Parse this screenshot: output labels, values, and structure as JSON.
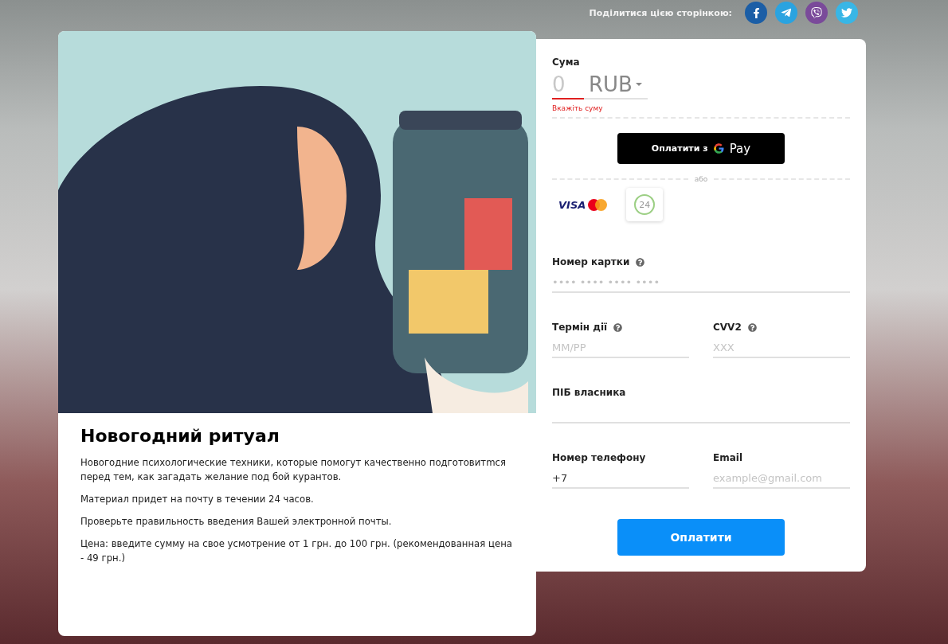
{
  "share": {
    "label": "Поділитися цією сторінкою:",
    "links": [
      {
        "kind": "facebook",
        "color": "#1b5ea6"
      },
      {
        "kind": "telegram",
        "color": "#2aa3e0"
      },
      {
        "kind": "viber",
        "color": "#7a4a9a"
      },
      {
        "kind": "twitter",
        "color": "#38b6e6"
      }
    ]
  },
  "product": {
    "title": "Новогодний ритуал",
    "paragraphs": [
      "Новогодние психологические техники, которые помогут качественно подготовитmся перед тем, как загадать желание под бой курантов.",
      "Материал придет на почту в течении 24 часов.",
      "Проверьте правильность введения Вашей электронной почты.",
      "Цена: введите сумму на свое усмотрение от 1 грн. до 100 грн. (рекомендованная цена - 49 грн.)"
    ]
  },
  "payment": {
    "amount": {
      "label": "Сума",
      "placeholder": "0",
      "currency": "RUB",
      "error": "Вкажіть суму"
    },
    "gpay": {
      "label": "Оплатити з",
      "brand": "Pay"
    },
    "divider": "або",
    "methods": [
      {
        "kind": "cards",
        "text": "VISA"
      },
      {
        "kind": "privat24",
        "text": "24"
      }
    ],
    "field_rows": [
      [
        {
          "label": "Номер картки",
          "help": true,
          "placeholder": "•••• •••• •••• ••••"
        }
      ],
      [
        {
          "label": "Термін дії",
          "help": true,
          "placeholder": "ММ/РР"
        },
        {
          "label": "CVV2",
          "help": true,
          "placeholder": "XXX"
        }
      ],
      [
        {
          "label": "ПІБ власника",
          "help": false
        }
      ],
      [
        {
          "label": "Номер телефону",
          "help": false,
          "value": "+7"
        },
        {
          "label": "Email",
          "help": false,
          "placeholder": "example@gmail.com"
        }
      ]
    ],
    "submit": "Оплатити"
  }
}
